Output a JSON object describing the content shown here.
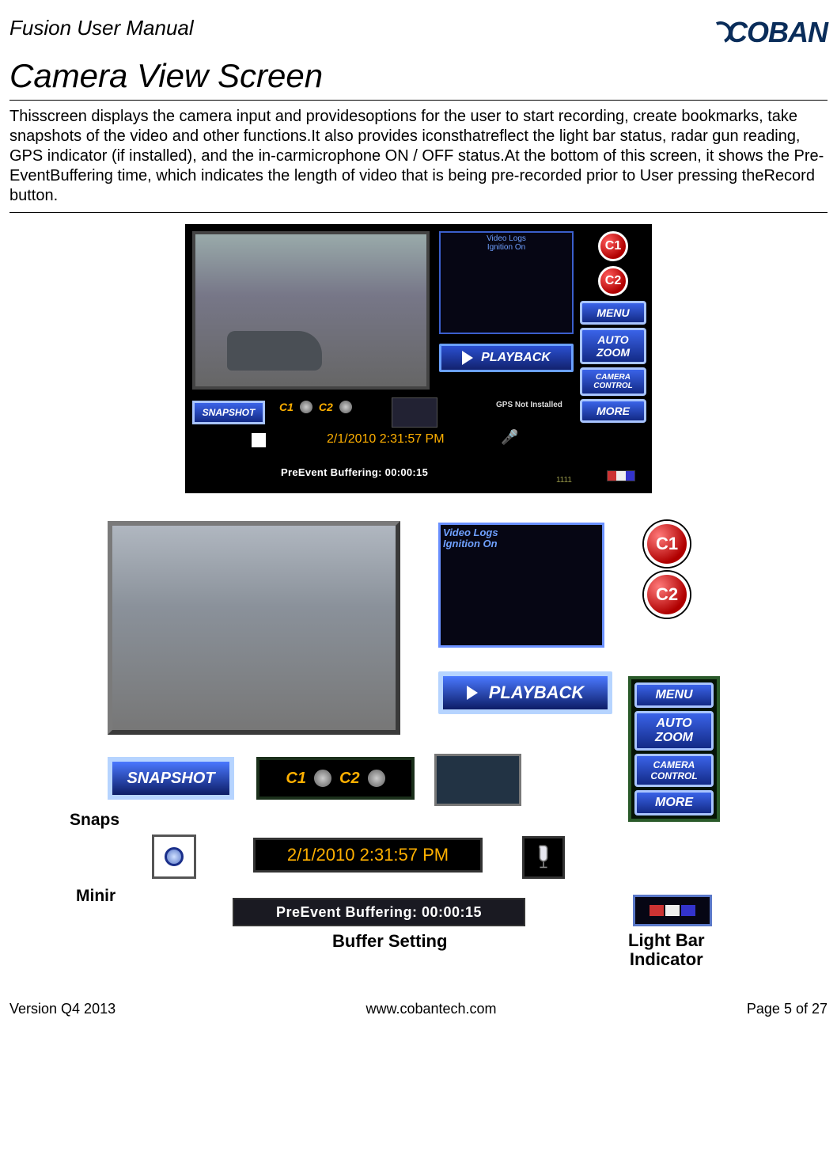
{
  "header": {
    "doc_title": "Fusion User Manual",
    "brand": "COBAN"
  },
  "section": {
    "title": "Camera View Screen"
  },
  "body_text": "Thisscreen displays the camera input and providesoptions for the user to start recording, create bookmarks, take snapshots of the video and other functions.It also provides iconsthatreflect the light bar status, radar gun reading, GPS indicator (if installed), and the in-carmicrophone ON / OFF status.At the bottom of this screen, it shows the Pre-EventBuffering time, which indicates the length of video that is being pre-recorded prior to User pressing theRecord button.",
  "ui": {
    "log_header": "Video Logs",
    "log_line": "Ignition On",
    "playback": "PLAYBACK",
    "snapshot": "SNAPSHOT",
    "c1": "C1",
    "c2": "C2",
    "gps": "GPS Not Installed",
    "timestamp": "2/1/2010 2:31:57 PM",
    "buffer": "PreEvent Buffering: 00:00:15",
    "bottom_num": "1111",
    "menu": "MENU",
    "autozoom_l1": "AUTO",
    "autozoom_l2": "ZOOM",
    "camctrl_l1": "CAMERA",
    "camctrl_l2": "CONTROL",
    "more": "MORE",
    "rec_c1": "C1",
    "rec_c2": "C2"
  },
  "labels": {
    "snapshot": "Snaps",
    "minimize": "Minir",
    "buffer": "Buffer Setting",
    "lightbar_l1": "Light Bar",
    "lightbar_l2": "Indicator"
  },
  "footer": {
    "version": "Version Q4 2013",
    "url": "www.cobantech.com",
    "page": "Page 5 of 27"
  }
}
